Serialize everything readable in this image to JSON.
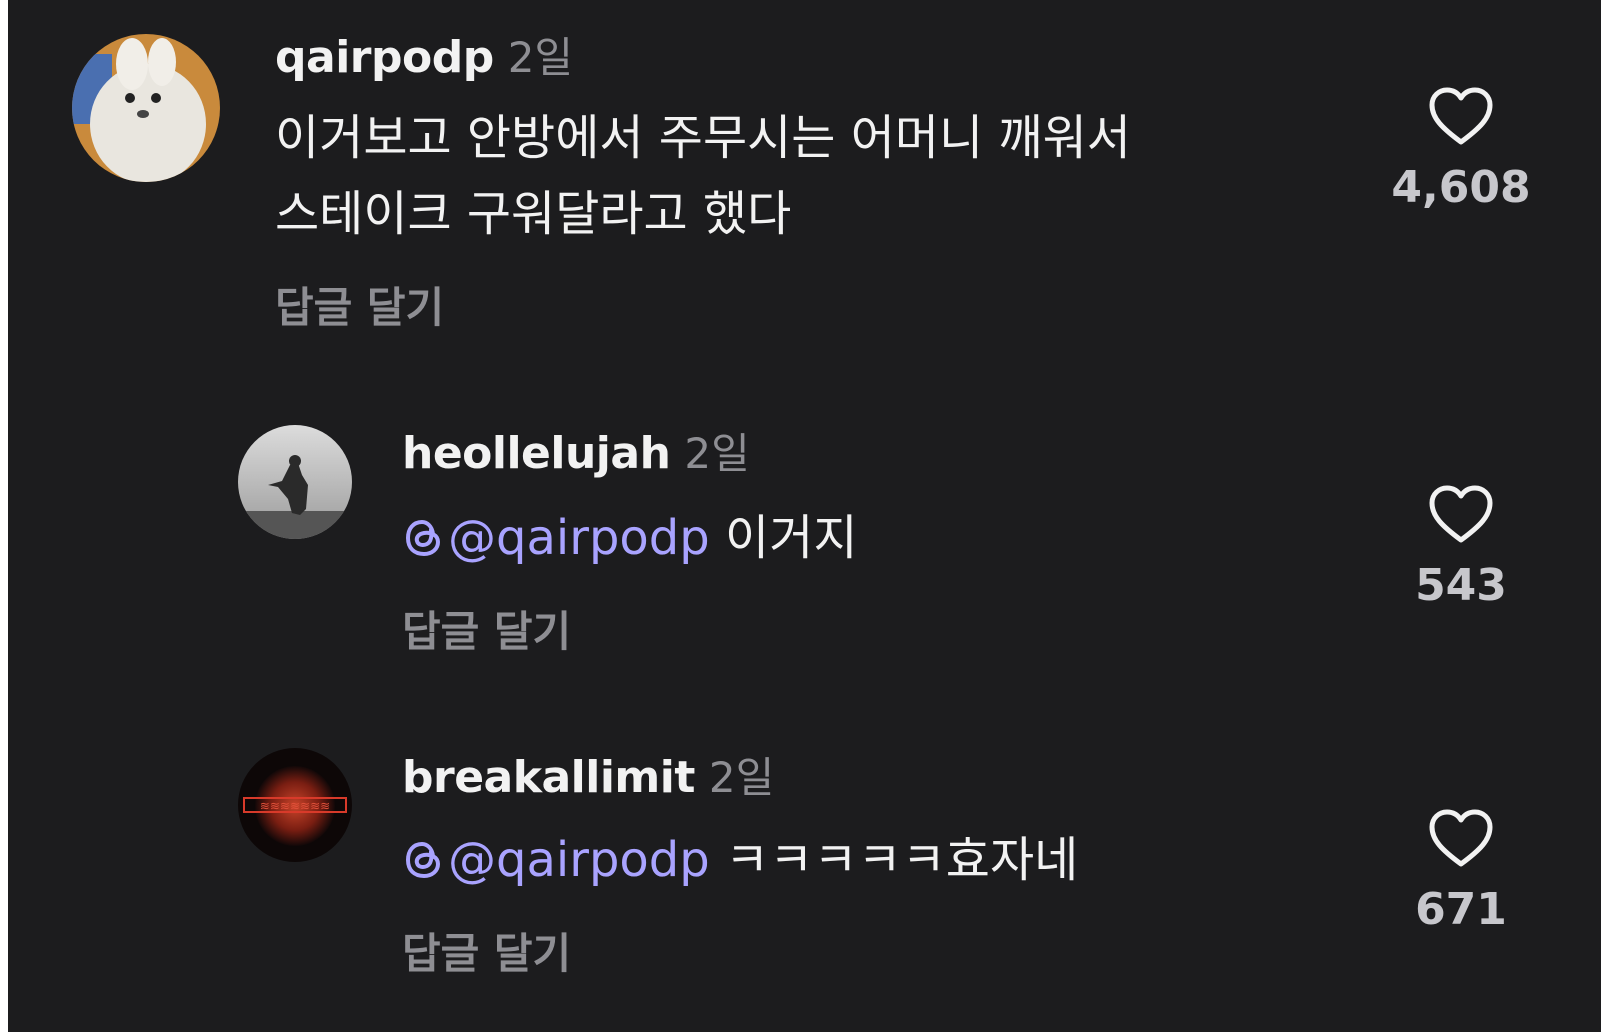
{
  "comments": [
    {
      "username": "qairpodp",
      "time": "2일",
      "text_lines": [
        "이거보고 안방에서 주무시는 어머니 깨워서",
        "스테이크 구워달라고 했다"
      ],
      "reply_label": "답글 달기",
      "likes": "4,608"
    },
    {
      "username": "heollelujah",
      "time": "2일",
      "mention": "@qairpodp",
      "text": "이거지",
      "reply_label": "답글 달기",
      "likes": "543"
    },
    {
      "username": "breakallimit",
      "time": "2일",
      "mention": "@qairpodp",
      "text": "ㅋㅋㅋㅋㅋ효자네",
      "reply_label": "답글 달기",
      "likes": "671"
    }
  ],
  "icons": {
    "like": "heart-outline-icon",
    "mention": "threads-icon"
  },
  "colors": {
    "background": "#1c1c1e",
    "text": "#f2f2f2",
    "muted": "#8e8e93",
    "mention": "#a9a3ff"
  }
}
